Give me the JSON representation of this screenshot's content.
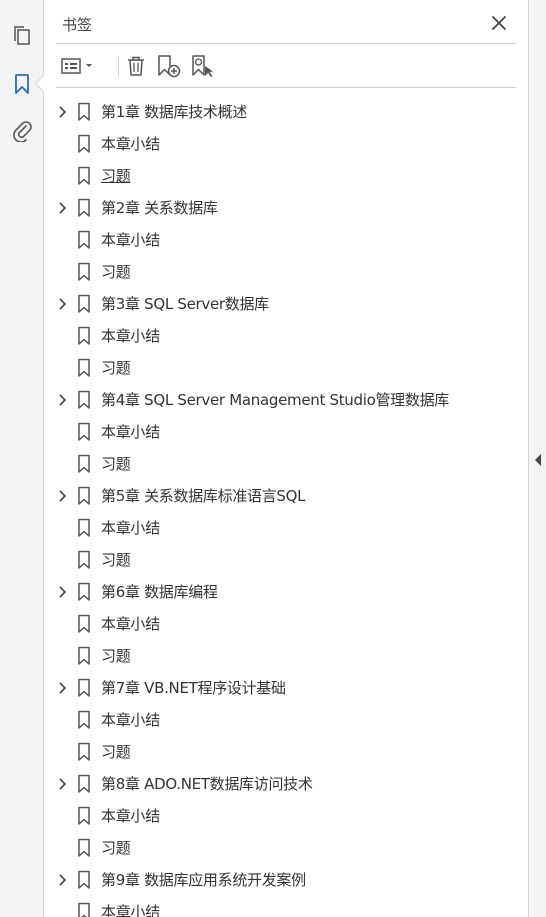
{
  "panel": {
    "title": "书签"
  },
  "toolbar": {
    "options_icon": "list-options-icon",
    "delete_icon": "trash-icon",
    "new_bookmark_icon": "new-bookmark-icon",
    "bookmark_from_selection_icon": "bookmark-find-icon"
  },
  "bookmarks": [
    {
      "label": "第1章 数据库技术概述",
      "expandable": true,
      "underline": false
    },
    {
      "label": "本章小结",
      "expandable": false,
      "underline": false
    },
    {
      "label": "习题",
      "expandable": false,
      "underline": true
    },
    {
      "label": "第2章 关系数据库",
      "expandable": true,
      "underline": false
    },
    {
      "label": "本章小结",
      "expandable": false,
      "underline": false
    },
    {
      "label": "习题",
      "expandable": false,
      "underline": false
    },
    {
      "label": "第3章 SQL Server数据库",
      "expandable": true,
      "underline": false
    },
    {
      "label": "本章小结",
      "expandable": false,
      "underline": false
    },
    {
      "label": "习题",
      "expandable": false,
      "underline": false
    },
    {
      "label": "第4章 SQL Server Management Studio管理数据库",
      "expandable": true,
      "underline": false
    },
    {
      "label": "本章小结",
      "expandable": false,
      "underline": false
    },
    {
      "label": "习题",
      "expandable": false,
      "underline": false
    },
    {
      "label": "第5章 关系数据库标准语言SQL",
      "expandable": true,
      "underline": false
    },
    {
      "label": "本章小结",
      "expandable": false,
      "underline": false
    },
    {
      "label": "习题",
      "expandable": false,
      "underline": false
    },
    {
      "label": "第6章 数据库编程",
      "expandable": true,
      "underline": false
    },
    {
      "label": "本章小结",
      "expandable": false,
      "underline": false
    },
    {
      "label": "习题",
      "expandable": false,
      "underline": false
    },
    {
      "label": "第7章 VB.NET程序设计基础",
      "expandable": true,
      "underline": false
    },
    {
      "label": "本章小结",
      "expandable": false,
      "underline": false
    },
    {
      "label": "习题",
      "expandable": false,
      "underline": false
    },
    {
      "label": "第8章 ADO.NET数据库访问技术",
      "expandable": true,
      "underline": false
    },
    {
      "label": "本章小结",
      "expandable": false,
      "underline": false
    },
    {
      "label": "习题",
      "expandable": false,
      "underline": false
    },
    {
      "label": "第9章 数据库应用系统开发案例",
      "expandable": true,
      "underline": false
    },
    {
      "label": "本章小结",
      "expandable": false,
      "underline": false
    }
  ],
  "left_rail": {
    "items": [
      "pages-icon",
      "bookmark-icon",
      "attachment-icon"
    ],
    "active": "bookmark-icon"
  },
  "colors": {
    "accent": "#2a6ebb",
    "icon": "#555555"
  }
}
